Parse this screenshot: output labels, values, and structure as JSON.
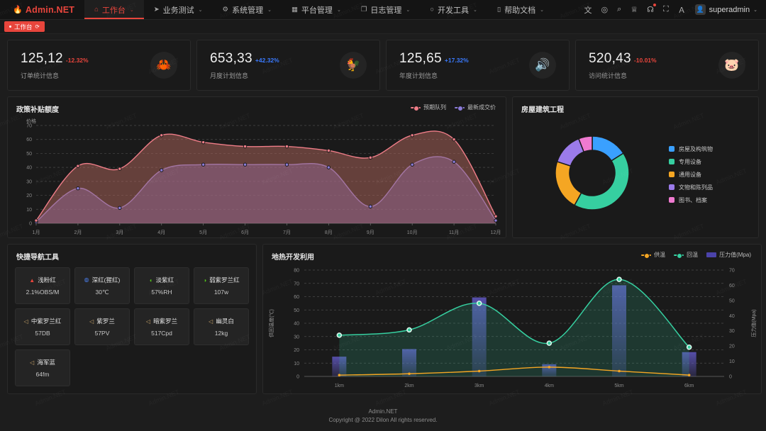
{
  "brand": {
    "name": "Admin.NET",
    "logo_icon": "fire-icon"
  },
  "topnav": {
    "items": [
      {
        "label": "工作台",
        "icon": "home-icon",
        "active": true,
        "caret": "⌄"
      },
      {
        "label": "业务测试",
        "icon": "send-icon",
        "active": false,
        "caret": "⌄"
      },
      {
        "label": "系统管理",
        "icon": "gear-icon",
        "active": false,
        "caret": "⌄"
      },
      {
        "label": "平台管理",
        "icon": "grid-icon",
        "active": false,
        "caret": "⌄"
      },
      {
        "label": "日志管理",
        "icon": "copy-icon",
        "active": false,
        "caret": "⌄"
      },
      {
        "label": "开发工具",
        "icon": "circle-icon",
        "active": false,
        "caret": "⌄"
      },
      {
        "label": "帮助文档",
        "icon": "book-icon",
        "active": false,
        "caret": "⌄"
      }
    ],
    "right_icons": [
      {
        "name": "translate-icon",
        "glyph": "文"
      },
      {
        "name": "theme-icon",
        "glyph": "◎"
      },
      {
        "name": "search-icon",
        "glyph": "⌕"
      },
      {
        "name": "shirt-icon",
        "glyph": "♕"
      },
      {
        "name": "bell-icon",
        "glyph": "☊",
        "badge": true
      },
      {
        "name": "fullscreen-icon",
        "glyph": "⛶"
      },
      {
        "name": "profile-icon",
        "glyph": "Ａ"
      }
    ],
    "username": "superadmin",
    "user_caret": "⌄"
  },
  "tabbar": {
    "tabs": [
      {
        "label": "工作台",
        "refresh_icon": "refresh-icon",
        "active": true
      }
    ]
  },
  "kpis": [
    {
      "value": "125,12",
      "delta": "-12.32%",
      "delta_color": "#e8453c",
      "label": "订单统计信息",
      "icon": "crab-icon",
      "icon_glyph": "🦀",
      "icon_color": "#e8453c"
    },
    {
      "value": "653,33",
      "delta": "+42.32%",
      "delta_color": "#3a7afe",
      "label": "月度计划信息",
      "icon": "chicken-icon",
      "icon_glyph": "🐓",
      "icon_color": "#52c41a"
    },
    {
      "value": "125,65",
      "delta": "+17.32%",
      "delta_color": "#3a7afe",
      "label": "年度计划信息",
      "icon": "speaker-icon",
      "icon_glyph": "🔊",
      "icon_color": "#faad14"
    },
    {
      "value": "520,43",
      "delta": "-10.01%",
      "delta_color": "#e8453c",
      "label": "访问统计信息",
      "icon": "pig-icon",
      "icon_glyph": "🐷",
      "icon_color": "#ff4d4f"
    }
  ],
  "panels": {
    "line": {
      "title": "政策补贴额度"
    },
    "donut": {
      "title": "房屋建筑工程"
    },
    "tools": {
      "title": "快捷导航工具"
    },
    "geo": {
      "title": "地热开发利用"
    }
  },
  "tools": [
    {
      "name": "浅粉红",
      "value": "2.1%OBS/M",
      "icon": "signal-icon",
      "icon_glyph": "▲",
      "icon_color": "#e8453c"
    },
    {
      "name": "深红(猩红)",
      "value": "30℃",
      "icon": "water-icon",
      "icon_glyph": "◍",
      "icon_color": "#4a7ce8"
    },
    {
      "name": "淡紫红",
      "value": "57%RH",
      "icon": "humidity-icon",
      "icon_glyph": "◐",
      "icon_color": "#52c41a"
    },
    {
      "name": "弱紫罗兰红",
      "value": "107w",
      "icon": "power-icon",
      "icon_glyph": "◑",
      "icon_color": "#52c41a"
    },
    {
      "name": "中紫罗兰红",
      "value": "57DB",
      "icon": "sound-icon",
      "icon_glyph": "◁",
      "icon_color": "#c8a46a"
    },
    {
      "name": "紫罗兰",
      "value": "57PV",
      "icon": "sound-icon",
      "icon_glyph": "◁",
      "icon_color": "#c8a46a"
    },
    {
      "name": "暗紫罗兰",
      "value": "517Cpd",
      "icon": "sound-icon",
      "icon_glyph": "◁",
      "icon_color": "#c8a46a"
    },
    {
      "name": "幽灵白",
      "value": "12kg",
      "icon": "sound-icon",
      "icon_glyph": "◁",
      "icon_color": "#c8a46a"
    },
    {
      "name": "海军蓝",
      "value": "64fm",
      "icon": "sound-icon",
      "icon_glyph": "◁",
      "icon_color": "#c8a46a"
    }
  ],
  "footer": {
    "title": "Admin.NET",
    "copyright": "Copyright @ 2022 Dilon All rights reserved."
  },
  "watermark": {
    "text": "Admin.NET"
  },
  "chart_data": [
    {
      "id": "policy-subsidy",
      "type": "line",
      "title": "政策补贴额度",
      "xlabel": "",
      "ylabel": "价格",
      "categories": [
        "1月",
        "2月",
        "3月",
        "4月",
        "5月",
        "6月",
        "7月",
        "8月",
        "9月",
        "10月",
        "11月",
        "12月"
      ],
      "ylim": [
        0,
        70
      ],
      "yticks": [
        0,
        10,
        20,
        30,
        40,
        50,
        60,
        70
      ],
      "grid": true,
      "legend_position": "top-right",
      "series": [
        {
          "name": "预期队列",
          "color": "#ef7d88",
          "area_color": "rgba(193,110,100,0.45)",
          "values": [
            2,
            41,
            39,
            63,
            58,
            55,
            55,
            52,
            47,
            63,
            60,
            5
          ]
        },
        {
          "name": "最新成交价",
          "color": "#8b7bd8",
          "area_color": "rgba(120,104,200,0.45)",
          "values": [
            1,
            25,
            11,
            38,
            42,
            42,
            42,
            40,
            12,
            42,
            44,
            2
          ]
        }
      ]
    },
    {
      "id": "building-engineering",
      "type": "pie",
      "title": "房屋建筑工程",
      "donut": true,
      "legend_position": "right",
      "labels": [
        "房屋及构筑物",
        "专用设备",
        "通用设备",
        "文物和陈列品",
        "图书、档案"
      ],
      "colors": [
        "#3aa0ff",
        "#36cfa0",
        "#f5a623",
        "#9b7bea",
        "#ef7ad0"
      ],
      "values": [
        16,
        42,
        22,
        14,
        6
      ]
    },
    {
      "id": "geothermal-development",
      "type": "line",
      "title": "地热开发利用",
      "xlabel": "",
      "ylabel": "供回温度(℃)",
      "y2label": "压力值(Mpa)",
      "categories": [
        "1km",
        "2km",
        "3km",
        "4km",
        "5km",
        "6km"
      ],
      "ylim": [
        0,
        80
      ],
      "yticks": [
        0,
        10,
        20,
        30,
        40,
        50,
        60,
        70,
        80
      ],
      "y2lim": [
        0,
        70
      ],
      "y2ticks": [
        0,
        10,
        20,
        30,
        40,
        50,
        60,
        70
      ],
      "grid": true,
      "legend_position": "top-right",
      "series": [
        {
          "name": "供温",
          "color": "#f5a623",
          "type": "line",
          "values": [
            1,
            2,
            4,
            7,
            4,
            1
          ]
        },
        {
          "name": "回温",
          "color": "#36cfa0",
          "type": "area",
          "values": [
            31,
            35,
            55,
            25,
            73,
            22
          ]
        },
        {
          "name": "压力值(Mpa)",
          "color": "#5b52c8",
          "type": "bar",
          "values": [
            13,
            18,
            52,
            8,
            60,
            16
          ]
        }
      ]
    }
  ]
}
